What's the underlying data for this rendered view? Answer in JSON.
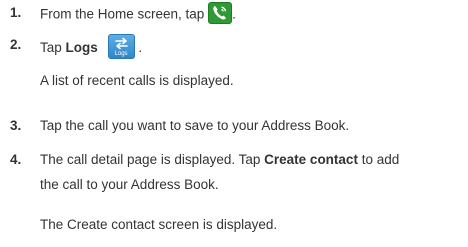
{
  "steps": [
    {
      "number": "1.",
      "text_before": "From the Home screen, tap",
      "icon": "phone-icon",
      "text_after": "."
    },
    {
      "number": "2.",
      "text_before": "Tap",
      "bold": "Logs",
      "icon": "logs-icon",
      "icon_caption": "Logs",
      "text_after": ".",
      "note": "A list of recent calls is displayed."
    },
    {
      "number": "3.",
      "text": "Tap the call you want to save to your Address Book."
    },
    {
      "number": "4.",
      "text_before": "The call detail page is displayed. Tap",
      "bold": "Create contact",
      "text_after": "to add",
      "line2": "the call to your Address Book.",
      "note": "The Create contact screen is displayed."
    }
  ],
  "colors": {
    "text": "#333333",
    "phone_icon": "#2e9a33",
    "logs_icon": "#3a93d3"
  }
}
